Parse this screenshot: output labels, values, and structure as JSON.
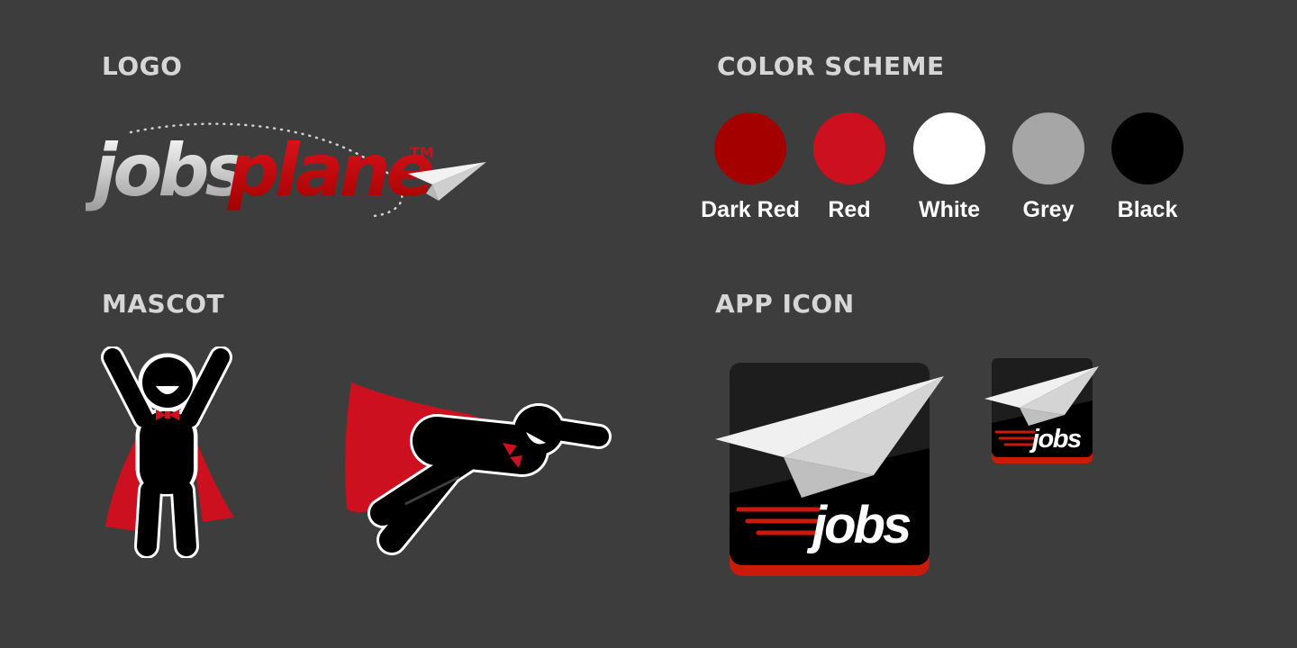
{
  "sections": {
    "logo": "LOGO",
    "color_scheme": "COLOR SCHEME",
    "mascot": "MASCOT",
    "app_icon": "APP ICON"
  },
  "logo": {
    "word_part1": "jobs",
    "word_part2": "plane",
    "trademark": "TM"
  },
  "colors": [
    {
      "name": "Dark Red",
      "hex": "#a50000"
    },
    {
      "name": "Red",
      "hex": "#cc101f"
    },
    {
      "name": "White",
      "hex": "#ffffff"
    },
    {
      "name": "Grey",
      "hex": "#a6a6a6"
    },
    {
      "name": "Black",
      "hex": "#000000"
    }
  ],
  "app_icon": {
    "label": "jobs"
  },
  "icons": [
    "paper-plane-icon",
    "mascot-cheering-icon",
    "mascot-flying-icon",
    "app-icon"
  ]
}
